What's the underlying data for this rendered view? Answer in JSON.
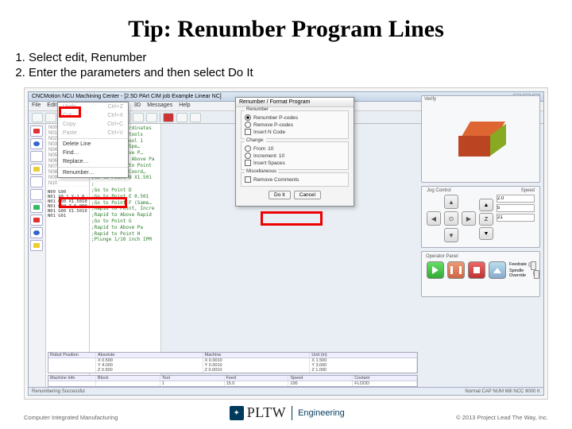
{
  "title": "Tip: Renumber Program Lines",
  "steps": [
    "Select edit, Renumber",
    "Enter the parameters and then select Do It"
  ],
  "window": {
    "title": "CNCMotion NCU Machining Center - [2.5D PArt CIM job Example Linear NC]",
    "menubar": [
      "File",
      "Edit",
      "Programs",
      "Tools",
      "Setup",
      "3D",
      "Messages",
      "Help"
    ]
  },
  "edit_menu": {
    "items": [
      {
        "label": "Undo",
        "accel": "Ctrl+Z",
        "dis": true
      },
      {
        "label": "Cut",
        "accel": "Ctrl+X",
        "dis": true
      },
      {
        "label": "Copy",
        "accel": "Ctrl+C",
        "dis": true
      },
      {
        "label": "Paste",
        "accel": "Ctrl+V",
        "dis": true
      },
      {
        "label": "Delete Line",
        "accel": "",
        "dis": false
      },
      {
        "label": "Find…",
        "accel": "",
        "dis": false
      },
      {
        "label": "Replace…",
        "accel": "",
        "dis": false
      },
      {
        "label": "Renumber…",
        "accel": "",
        "dis": false
      }
    ]
  },
  "nc_rows": [
    {
      "ln": "N00",
      "v": ""
    },
    {
      "ln": "N01",
      "v": ""
    },
    {
      "ln": "N02",
      "v": ""
    },
    {
      "ln": "N03",
      "v": ""
    },
    {
      "ln": "N04",
      "v": ""
    },
    {
      "ln": "N05",
      "v": ""
    },
    {
      "ln": "N06",
      "v": ""
    },
    {
      "ln": "N07",
      "v": ""
    },
    {
      "ln": "N08",
      "v": ""
    },
    {
      "ln": "N09",
      "v": ""
    },
    {
      "ln": "N10",
      "v": ""
    }
  ],
  "code_lines": [
    ";Absolute Coordinates",
    ";2-panel for tools",
    ";G90 Change Tool 1",
    ";Rapid to CW Spe…",
    ";Rapid to Above P…",
    ";Rapid to 0.1 Above Pa",
    ";Plunge Down to Point",
    ";Incremental Coord…",
    ";Go to Point B X1.501",
    ";",
    ";Go to Point D",
    ";Go to Point E 0.501",
    ";Go to Point F (Same…",
    ";Rapid to Point, Incre",
    ";Rapid to Above Rapid",
    ";Go to Point G",
    ";Rapid to Above Pa",
    ";Rapid to Point H",
    ";Plunge 1/10 inch IPM"
  ],
  "nc_block": [
    "N00 G90",
    "N01 X0.1 Y-1.0 M11 T.0",
    "N01 G00 X1.5010 T0",
    "N01 G00 Z 5.000 T.5",
    "N01 G00 X1.5010 Y3.925",
    "N01 G01"
  ],
  "dialog": {
    "title": "Renumber / Format Program",
    "renumber_grp": "Renumber",
    "insert_ncode": "Insert N Code",
    "opt_renumber": "Renumber P-codes",
    "opt_remove": "Remove P-codes",
    "change_grp": "Change:",
    "from_label": "From",
    "from_val": "10",
    "increment_label": "Increment",
    "increment_val": "10",
    "spaces_label": "Insert Spaces",
    "misc_grp": "Miscellaneous",
    "rm_comments": "Remove Comments",
    "btn_doit": "Do It",
    "btn_cancel": "Cancel"
  },
  "right": {
    "verify_label": "Verify",
    "jog_label": "Jog Control",
    "speed_label": "Speed",
    "jog_val": "2.0",
    "speed_val1": "5",
    "speed_val2": "21",
    "op_label": "Operator Panel",
    "feed_label": "Feedrate",
    "spindle_label": "Spindle Override"
  },
  "tables": {
    "pos": {
      "title": "Robot Position",
      "cols": [
        "Absolute",
        "Machine",
        "Unit (in)"
      ],
      "rows": [
        [
          "X 0.500",
          "X 0.0010",
          "X 1.500"
        ],
        [
          "Y 4.000",
          "Y 0.0010",
          "Y 3.000"
        ],
        [
          "Z 0.500",
          "Z 0.0010",
          "Z 1.000"
        ]
      ]
    },
    "mach": {
      "title": "Machine Info",
      "cols": [
        "Block",
        "Tool",
        "Feed",
        "Speed",
        "Coolant"
      ],
      "rows": [
        [
          "",
          "1",
          "15.0",
          "100",
          "FLOOD"
        ]
      ]
    }
  },
  "statusbar": {
    "left": "Renumbering Successful",
    "right": "Normal   CAP  NUM   Mill  NCC  9000  K"
  },
  "footer": {
    "course": "Computer Integrated Manufacturing",
    "brand1": "PLTW",
    "brand2": "Engineering",
    "credit": "© 2013 Project Lead The Way, Inc."
  }
}
